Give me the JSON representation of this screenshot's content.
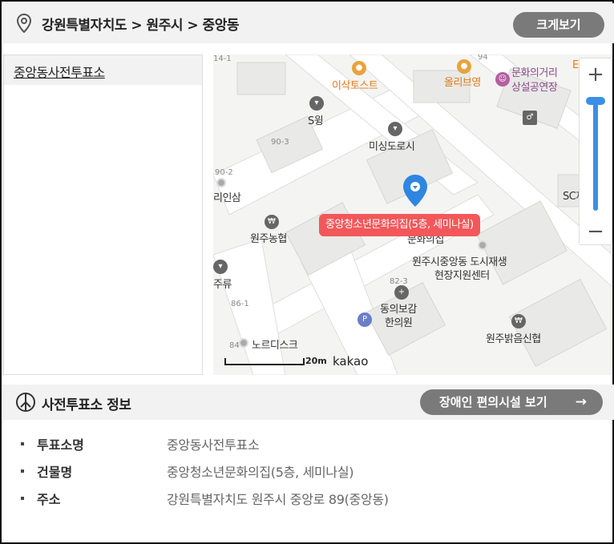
{
  "header": {
    "location": "강원특별자치도 > 원주시 > 중앙동",
    "enlarge_label": "크게보기"
  },
  "list": {
    "items": [
      "중앙동사전투표소"
    ]
  },
  "map": {
    "callout": "중앙청소년문화의집(5층, 세미나실)",
    "scale": "20m",
    "brand": "kakao",
    "zoom_in": "+",
    "zoom_out": "−",
    "labels": {
      "toast": "이삭토스트",
      "oliveyoung": "올리브영",
      "culture1": "문화의거리",
      "culture2": "상설공연장",
      "swing": "S윙",
      "misingdorosi": "미싱도로시",
      "inssam": "리인삼",
      "nonghyup": "원주농협",
      "junghwa": "문화의집",
      "regen1": "원주시중앙동 도시재생",
      "regen2": "현장지원센터",
      "jooryu": "주류",
      "dongui1": "동의보감",
      "dongui2": "한의원",
      "nordisk": "노르디스크",
      "bank": "원주밝음신협",
      "sc": "SC제일은행",
      "e": "E"
    },
    "nums": {
      "n1": "14-1",
      "n2": "94",
      "n3": "90-3",
      "n4": "90-2",
      "n5": "82-3",
      "n6": "86-1",
      "n7": "84"
    }
  },
  "info": {
    "title": "사전투표소 정보",
    "accessibility_label": "장애인 편의시설 보기",
    "arrow": "→",
    "rows": [
      {
        "label": "투표소명",
        "value": "중앙동사전투표소"
      },
      {
        "label": "건물명",
        "value": "중앙청소년문화의집(5층, 세미나실)"
      },
      {
        "label": "주소",
        "value": "강원특별자치도 원주시 중앙로 89(중앙동)"
      }
    ]
  },
  "colors": {
    "callout": "#f2585a",
    "marker": "#2f86e0",
    "button": "#7a7a7a"
  }
}
